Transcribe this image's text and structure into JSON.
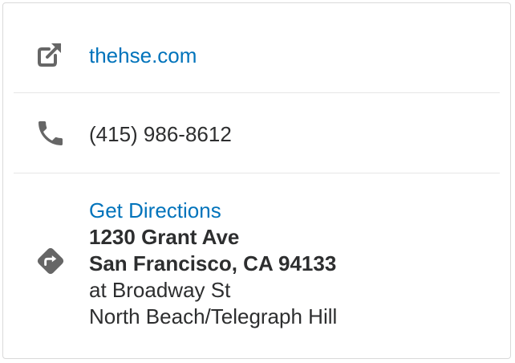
{
  "website": {
    "icon": "external-link-icon",
    "label": "thehse.com"
  },
  "phone": {
    "icon": "phone-icon",
    "number": "(415) 986-8612"
  },
  "directions": {
    "icon": "directions-icon",
    "link_label": "Get Directions",
    "street": "1230 Grant Ave",
    "city_line": "San Francisco, CA 94133",
    "cross_street": "at Broadway St",
    "neighborhood": "North Beach/Telegraph Hill"
  },
  "colors": {
    "link": "#0073bb",
    "text": "#2d2e2f",
    "icon": "#666666",
    "border": "#d9d9d9"
  }
}
